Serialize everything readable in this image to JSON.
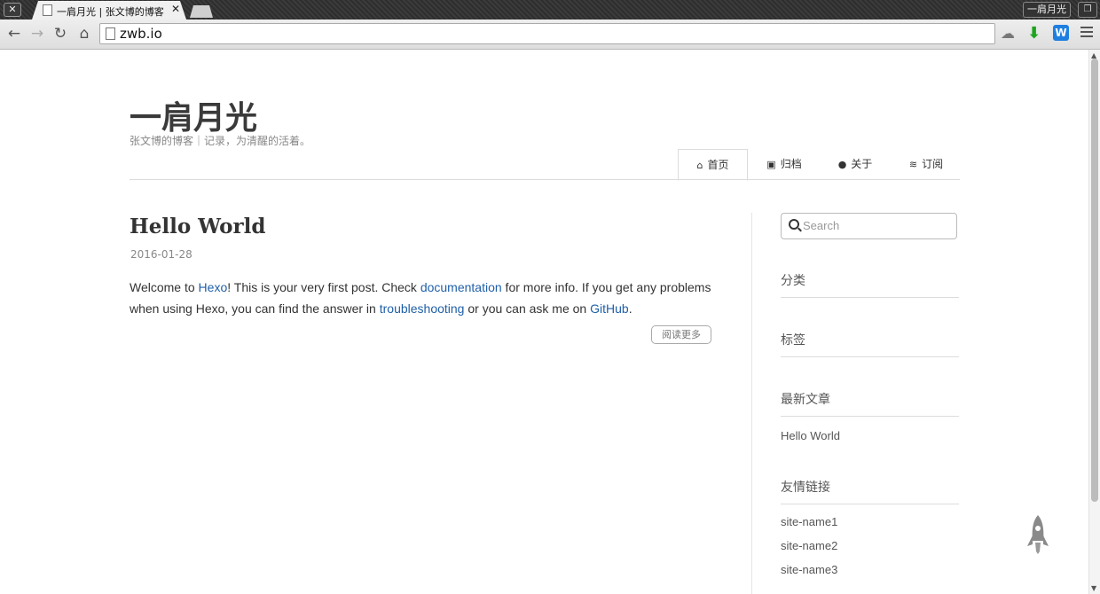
{
  "browser": {
    "tab_title": "一肩月光 | 张文博的博客",
    "tab_close": "✕",
    "url": "zwb.io",
    "profile_name": "一肩月光",
    "window_close": "✕",
    "restore_icon": "❐",
    "toolbar_icons": [
      "back-icon",
      "forward-icon",
      "reload-icon",
      "home-icon",
      "cloud-icon",
      "download-icon",
      "w-extension-icon",
      "menu-icon"
    ]
  },
  "site": {
    "title": "一肩月光",
    "subtitle": "张文博的博客｜记录，为清醒的活着。"
  },
  "nav": {
    "items": [
      {
        "label": "首页",
        "icon": "home-icon",
        "glyph": "⌂"
      },
      {
        "label": "归档",
        "icon": "archive-icon",
        "glyph": "▣"
      },
      {
        "label": "关于",
        "icon": "user-icon",
        "glyph": "●"
      },
      {
        "label": "订阅",
        "icon": "rss-icon",
        "glyph": "≋"
      }
    ],
    "active": 0
  },
  "post": {
    "title": "Hello World",
    "date": "2016-01-28",
    "body": {
      "t1": "Welcome to ",
      "link_hexo": "Hexo",
      "t2": "! This is your very first post. Check ",
      "link_docs": "documentation",
      "t3": " for more info. If you get any problems when using Hexo, you can find the answer in ",
      "link_trouble": "troubleshooting",
      "t4": " or you can ask me on ",
      "link_github": "GitHub",
      "t5": "."
    },
    "read_more": "阅读更多"
  },
  "sidebar": {
    "search_placeholder": "Search",
    "categories_title": "分类",
    "tags_title": "标签",
    "recent_title": "最新文章",
    "recent_posts": [
      "Hello World"
    ],
    "links_title": "友情链接",
    "links": [
      "site-name1",
      "site-name2",
      "site-name3"
    ]
  },
  "colors": {
    "link": "#1f5fa8",
    "download_arrow": "#1fa31f",
    "extension_w": "#1e7fe0"
  }
}
